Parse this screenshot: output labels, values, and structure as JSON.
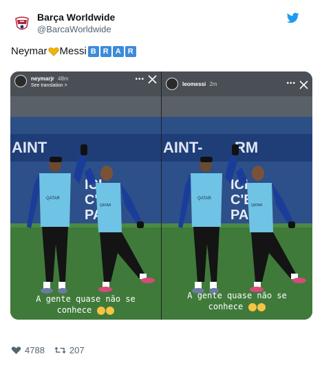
{
  "tweet": {
    "author_name": "Barça Worldwide",
    "author_handle": "@BarcaWorldwide",
    "text_part1": "Neymar",
    "text_part2": "Messi",
    "boxed_letters": [
      "B",
      "R",
      "A",
      "R"
    ],
    "icons": [
      "club-crest-icon",
      "twitter-bird-icon",
      "yellow-heart-icon"
    ]
  },
  "stories": [
    {
      "username": "neymarjr",
      "time": "48m",
      "translation": "See translation >",
      "caption_line1": "A gente quase não se",
      "caption_line2": "conhece"
    },
    {
      "username": "leomessi",
      "time": "2m",
      "translation": "",
      "caption_line1": "A gente quase não se",
      "caption_line2": "conhece"
    }
  ],
  "footer": {
    "likes": "4788",
    "retweets": "207"
  },
  "colors": {
    "twitter_blue": "#1d9bf0",
    "letter_box": "#3d8bd9",
    "pitch_green": "#3f7a3a",
    "stand_blue": "#1c3c7a"
  }
}
